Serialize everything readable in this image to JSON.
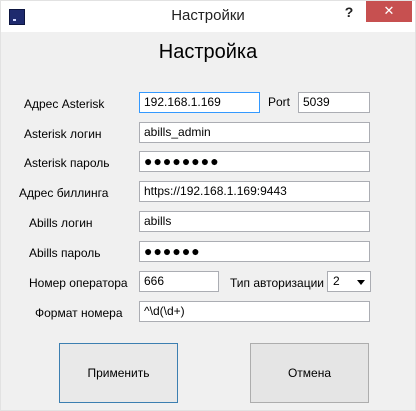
{
  "window": {
    "title": "Настройки",
    "help": "?",
    "close": "✕"
  },
  "heading": "Настройка",
  "fields": {
    "asterisk_address": {
      "label": "Адрес Asterisk",
      "value": "192.168.1.169"
    },
    "port": {
      "label": "Port",
      "value": "5039"
    },
    "asterisk_login": {
      "label": "Asterisk логин",
      "value": "abills_admin"
    },
    "asterisk_password": {
      "label": "Asterisk пароль",
      "value": "●●●●●●●●"
    },
    "billing_address": {
      "label": "Адрес биллинга",
      "value": "https://192.168.1.169:9443"
    },
    "abills_login": {
      "label": "Abills логин",
      "value": "abills"
    },
    "abills_password": {
      "label": "Abills пароль",
      "value": "●●●●●●"
    },
    "operator_number": {
      "label": "Номер оператора",
      "value": "666"
    },
    "auth_type": {
      "label": "Тип авторизации",
      "value": "2"
    },
    "number_format": {
      "label": "Формат номера",
      "value": "^\\d(\\d+)"
    }
  },
  "buttons": {
    "apply": "Применить",
    "cancel": "Отмена"
  }
}
